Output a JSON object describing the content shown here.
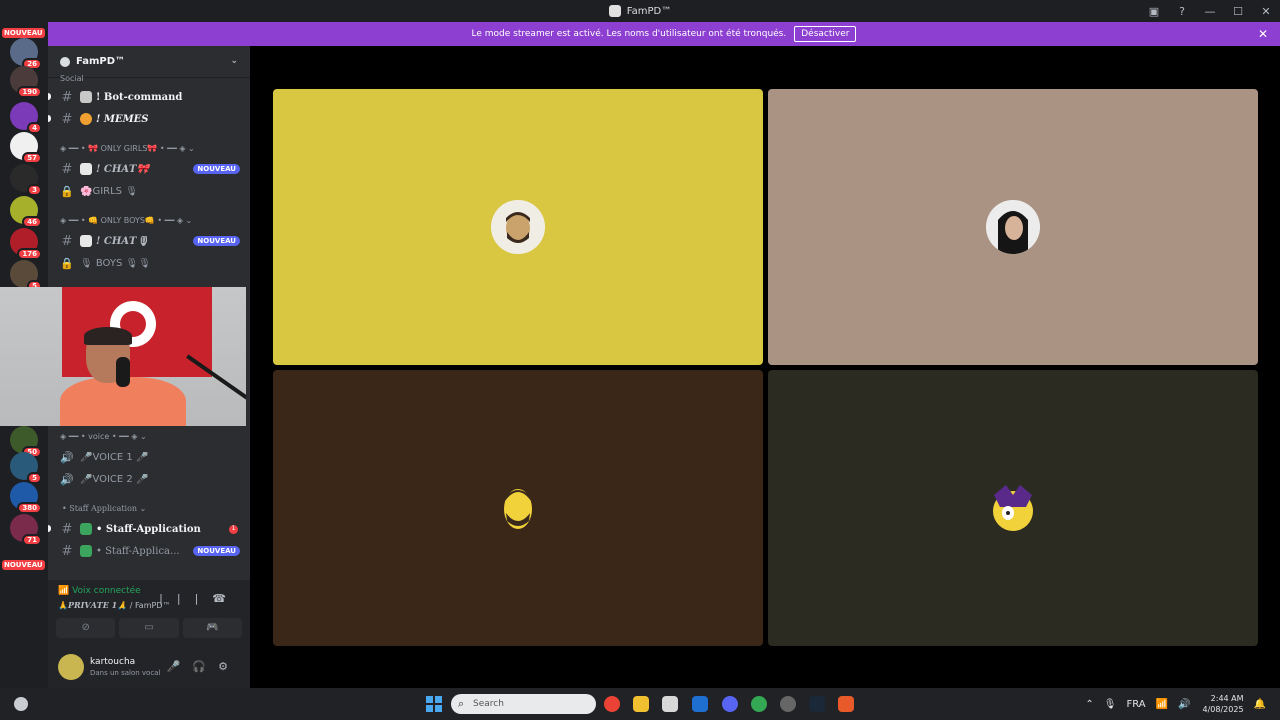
{
  "window": {
    "title": "FamPD™"
  },
  "banner": {
    "text": "Le mode streamer est activé. Les noms d'utilisateur ont été tronqués.",
    "button": "Désactiver",
    "close": "✕"
  },
  "guilds": {
    "top_badge": "14",
    "new_label": "NOUVEAU",
    "badges": [
      "26",
      "190",
      "4",
      "57",
      "3",
      "46",
      "176",
      "5",
      "50",
      "5",
      "380",
      "71"
    ],
    "bottom_new": "NOUVEAU"
  },
  "server": {
    "name": "FamPD™"
  },
  "channels": {
    "cat_social": "Social",
    "bot_command": "! Bot-command",
    "memes": "! 𝑴𝑬𝑴𝑬𝑺",
    "cat_girls": "◈ ━━ • 🎀 ONLY GIRLS🎀 • ━━ ◈ ⌄",
    "chat_girls": "! 𝑪𝑯𝑨𝑻🎀",
    "girls_voice": "🌸GIRLS 🎙",
    "cat_boys": "◈ ━━ • 👊 ONLY BOYS👊 • ━━ ◈ ⌄",
    "chat_boys": "! 𝑪𝑯𝑨𝑻🎙",
    "boys_voice": "🎙 BOYS 🎙🎙",
    "cat_voice": "◈ ━━ • voice • ━━ ◈ ⌄",
    "voice1": "🎤VOICE 1 🎤",
    "voice2": "🎤VOICE 2 🎤",
    "cat_staff": "• Staff Application ⌄",
    "staff_app": "• Staff-Application",
    "staff_app2": "• Staff-Applica...",
    "new_label": "NOUVEAU",
    "mention": "1"
  },
  "voice": {
    "status": "Voix connectée",
    "channel_prefix": "🙏",
    "channel_name": "𝑷𝑹𝑰𝑽𝑨𝑻𝑬 1🙏",
    "server": " / FamPD™"
  },
  "user": {
    "name": "kartoucha",
    "status": "Dans un salon vocal"
  },
  "stage": {
    "tiles": [
      {
        "color": "#d9c641"
      },
      {
        "color": "#ab9384"
      },
      {
        "color": "#3a2717"
      },
      {
        "color": "#2b2b22"
      }
    ]
  },
  "taskbar": {
    "search": "Search",
    "lang": "FRA",
    "time": "2:44 AM",
    "date": "4/08/2025"
  }
}
